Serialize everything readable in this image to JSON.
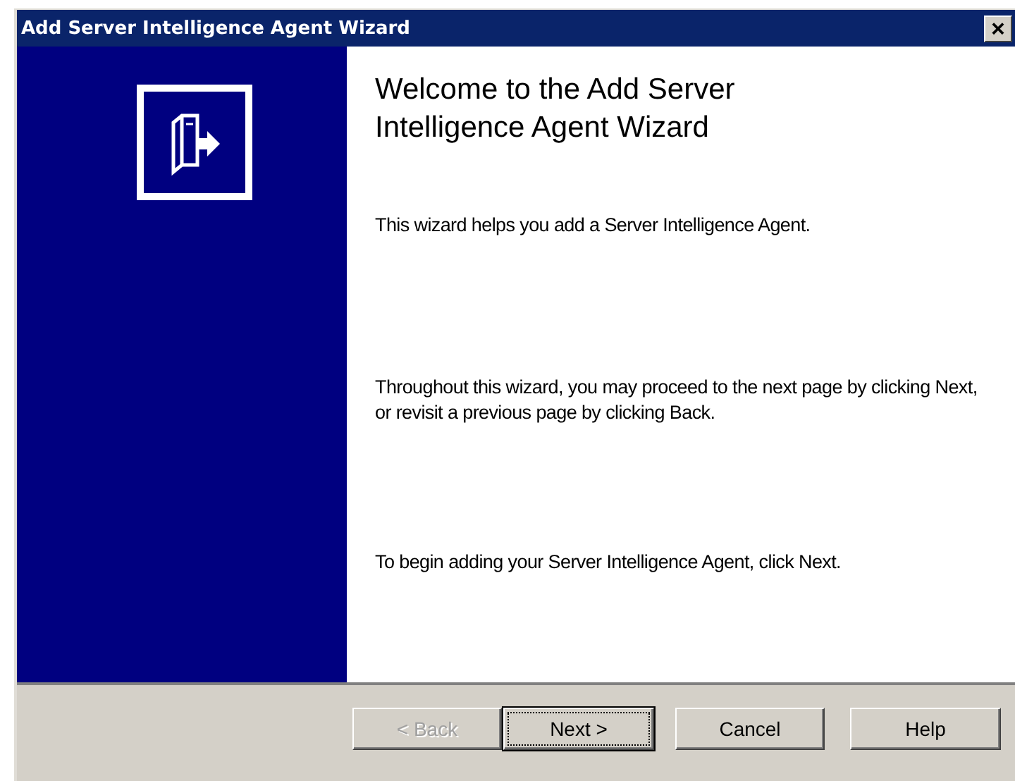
{
  "window": {
    "title": "Add Server Intelligence Agent Wizard",
    "close": "×"
  },
  "heading": "Welcome to the Add Server Intelligence Agent Wizard",
  "paragraphs": [
    "This wizard helps you add a Server Intelligence Agent.",
    "Throughout this wizard, you may proceed to the next page by clicking Next, or revisit a previous page by clicking Back.",
    "To begin adding your Server Intelligence Agent, click Next."
  ],
  "buttons": [
    {
      "label": "< Back",
      "disabled": true,
      "default": false
    },
    {
      "label": "Next >",
      "disabled": false,
      "default": true
    },
    {
      "label": "Cancel",
      "disabled": false,
      "default": false
    },
    {
      "label": "Help",
      "disabled": false,
      "default": false
    }
  ]
}
